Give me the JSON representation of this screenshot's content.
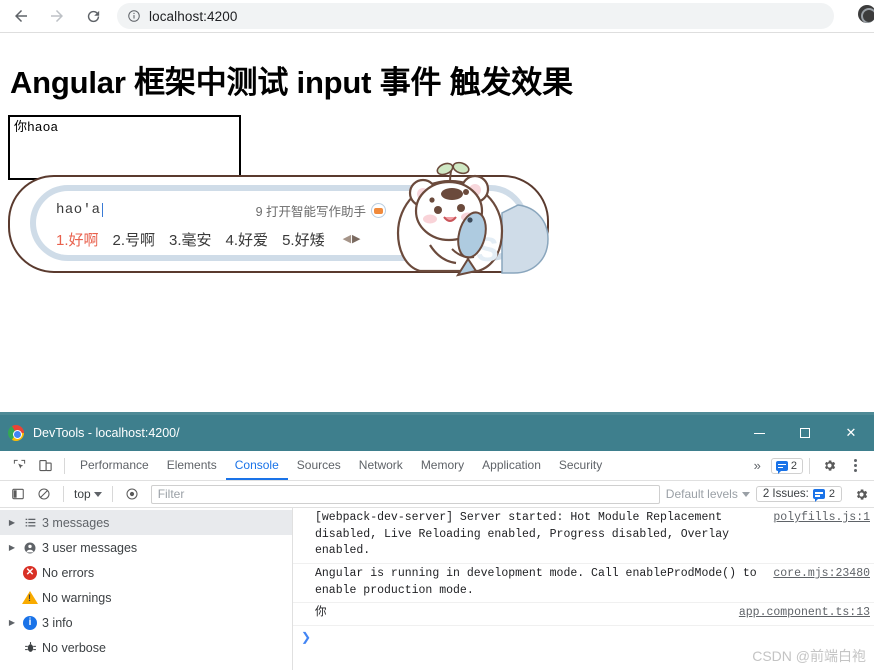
{
  "browser": {
    "back_label": "back-arrow",
    "forward_label": "forward-arrow",
    "reload_label": "reload",
    "site_info_label": "site-info",
    "url": "localhost:4200"
  },
  "page": {
    "heading": "Angular 框架中测试 input 事件 触发效果",
    "input_value": "你haoa"
  },
  "ime": {
    "composition": "hao'a",
    "assistant_text": "9 打开智能写作助手",
    "candidates": [
      {
        "label": "1.好啊",
        "active": true
      },
      {
        "label": "2.号啊",
        "active": false
      },
      {
        "label": "3.毫安",
        "active": false
      },
      {
        "label": "4.好爱",
        "active": false
      },
      {
        "label": "5.好矮",
        "active": false
      }
    ],
    "prev_arrow": "◀",
    "next_arrow": "▶",
    "active_color": "#e8604c",
    "border_color": "#5a3a2e",
    "inner_border_color": "#cfdce8"
  },
  "devtools": {
    "window_title": "DevTools - localhost:4200/",
    "minimize_label": "minimize",
    "maximize_label": "maximize",
    "close_label": "✕",
    "tabs": [
      {
        "label": "Performance",
        "active": false
      },
      {
        "label": "Elements",
        "active": false
      },
      {
        "label": "Console",
        "active": true
      },
      {
        "label": "Sources",
        "active": false
      },
      {
        "label": "Network",
        "active": false
      },
      {
        "label": "Memory",
        "active": false
      },
      {
        "label": "Application",
        "active": false
      },
      {
        "label": "Security",
        "active": false
      }
    ],
    "overflow_label": "»",
    "message_badge_count": "2",
    "filterbar": {
      "context": "top",
      "filter_placeholder": "Filter",
      "levels_label": "Default levels",
      "issues_label": "2 Issues:",
      "issues_count": "2"
    },
    "sidebar": [
      {
        "label": "3 messages",
        "icon": "list-icon",
        "expandable": true,
        "selected": true
      },
      {
        "label": "3 user messages",
        "icon": "user-icon",
        "expandable": true,
        "selected": false
      },
      {
        "label": "No errors",
        "icon": "error-icon",
        "expandable": false,
        "selected": false
      },
      {
        "label": "No warnings",
        "icon": "warning-icon",
        "expandable": false,
        "selected": false
      },
      {
        "label": "3 info",
        "icon": "info-icon",
        "expandable": true,
        "selected": false
      },
      {
        "label": "No verbose",
        "icon": "verbose-icon",
        "expandable": false,
        "selected": false
      }
    ],
    "messages": [
      {
        "text": "[webpack-dev-server] Server started: Hot Module Replacement disabled, Live Reloading enabled, Progress disabled, Overlay enabled.",
        "source": "polyfills.js:1"
      },
      {
        "text": "Angular is running in development mode. Call enableProdMode() to enable production mode.",
        "source": "core.mjs:23480"
      },
      {
        "text": "你",
        "source": "app.component.ts:13"
      }
    ],
    "prompt_caret": "❯",
    "watermark": "CSDN @前端白袍"
  }
}
